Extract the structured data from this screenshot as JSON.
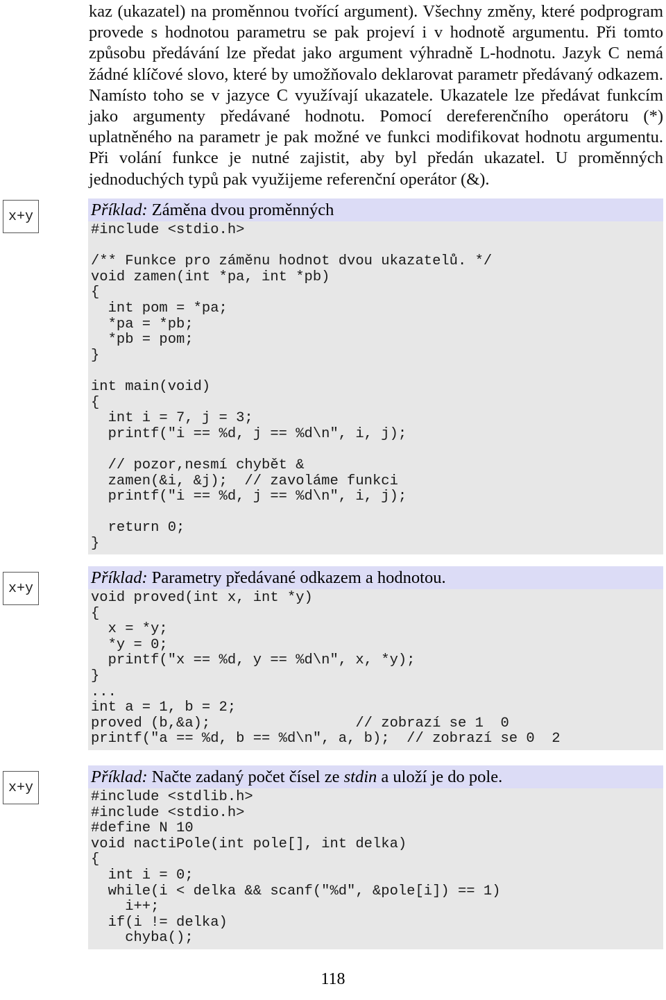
{
  "document": {
    "page_number": "118",
    "colors": {
      "example_header_bg": "#dcdcf6",
      "code_bg": "#e7e7e7",
      "icon_border": "#555555",
      "text": "#111111"
    }
  },
  "intro": {
    "paragraph": "kaz (ukazatel) na proměnnou tvořící argument). Všechny změny, které podprogram provede s hodnotou parametru se pak projeví i v hodnotě argumentu. Při tomto způsobu předávání lze předat jako argument výhradně L-hodnotu. Jazyk C nemá žádné klíčové slovo, které by umožňovalo deklarovat parametr předávaný odkazem. Namísto toho se v jazyce C využívají ukazatele. Ukazatele lze předávat funkcím jako argumenty předávané hodnotu. Pomocí dereferenčního operátoru (*) uplatněného na parametr je pak možné ve funkci modifikovat hodnotu argumentu. Při volání funkce je nutné zajistit, aby byl předán ukazatel. U proměnných jednoduchých typů pak využijeme referenční operátor (&)."
  },
  "examples": [
    {
      "icon_label": "x+y",
      "icon_name": "example-marker-icon",
      "header_prefix": "Příklad:",
      "header_text": " Záměna dvou proměnných",
      "code": "#include <stdio.h>\n\n/** Funkce pro záměnu hodnot dvou ukazatelů. */\nvoid zamen(int *pa, int *pb)\n{\n  int pom = *pa;\n  *pa = *pb;\n  *pb = pom;\n}\n\nint main(void)\n{\n  int i = 7, j = 3;\n  printf(\"i == %d, j == %d\\n\", i, j);\n\n  // pozor,nesmí chybět &\n  zamen(&i, &j);  // zavoláme funkci\n  printf(\"i == %d, j == %d\\n\", i, j);\n\n  return 0;\n}"
    },
    {
      "icon_label": "x+y",
      "icon_name": "example-marker-icon",
      "header_prefix": "Příklad:",
      "header_text": " Parametry předávané odkazem a hodnotou.",
      "code": "void proved(int x, int *y)\n{\n  x = *y;\n  *y = 0;\n  printf(\"x == %d, y == %d\\n\", x, *y);\n}\n...\nint a = 1, b = 2;\nproved (b,&a);                 // zobrazí se 1  0\nprintf(\"a == %d, b == %d\\n\", a, b);  // zobrazí se 0  2"
    },
    {
      "icon_label": "x+y",
      "icon_name": "example-marker-icon",
      "header_prefix": "Příklad:",
      "header_text_parts": [
        "Načte zadaný počet čísel ze ",
        "stdin",
        " a uloží je do pole."
      ],
      "header_text": " Načte zadaný počet čísel ze stdin a uloží je do pole.",
      "code": "#include <stdlib.h>\n#include <stdio.h>\n#define N 10\nvoid nactiPole(int pole[], int delka)\n{\n  int i = 0;\n  while(i < delka && scanf(\"%d\", &pole[i]) == 1)\n    i++;\n  if(i != delka)\n    chyba();"
    }
  ]
}
